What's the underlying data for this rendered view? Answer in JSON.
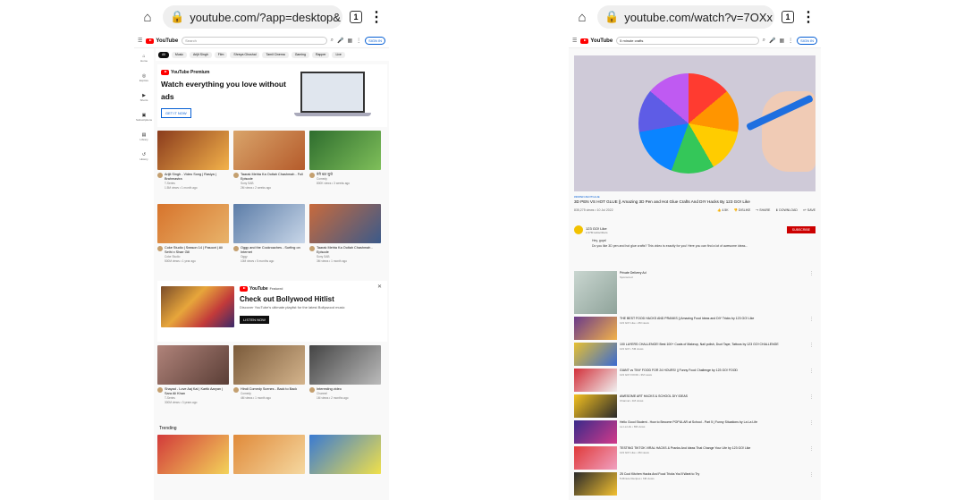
{
  "left": {
    "url": "youtube.com/?app=desktop&",
    "tab_count": "1",
    "yt": {
      "logo_text": "YouTube",
      "search_placeholder": "Search",
      "sign_in": "SIGN IN"
    },
    "rail": [
      "Home",
      "Explore",
      "Shorts",
      "Subscriptions",
      "Library",
      "History"
    ],
    "chips": [
      "All",
      "Music",
      "Arijit Singh",
      "Film",
      "Shreya Ghoshal",
      "Tamil Cinema",
      "Gaming",
      "Rapper",
      "Live"
    ],
    "promo": {
      "brand": "YouTube Premium",
      "title": "Watch everything you love without ads",
      "button": "GET IT NOW"
    },
    "videos": [
      {
        "title": "Arijit Singh - Video Song | Rasiya | Brahmastra",
        "channel": "T-Series",
        "meta": "1.5M views • 1 month ago",
        "c1": "#8a3b1d",
        "c2": "#f3b24a"
      },
      {
        "title": "Taarak Mehta Ka Ooltah Chashmah - Full Episode",
        "channel": "Sony SAB",
        "meta": "2M views • 2 weeks ago",
        "c1": "#d9a46a",
        "c2": "#b55b2b"
      },
      {
        "title": "मेरी बात सुनो",
        "channel": "Comedy",
        "meta": "800K views • 3 weeks ago",
        "c1": "#2e6d2e",
        "c2": "#7fbf5a"
      },
      {
        "title": "Coke Studio | Season 14 | Pasoori | Ali Sethi x Shae Gill",
        "channel": "Coke Studio",
        "meta": "500M views • 1 year ago",
        "c1": "#d7742c",
        "c2": "#e8b36a"
      },
      {
        "title": "Oggy and the Cockroaches - Surfing on Internet",
        "channel": "Oggy",
        "meta": "10M views • 5 months ago",
        "c1": "#5c7da8",
        "c2": "#c8d6e8"
      },
      {
        "title": "Taarak Mehta Ka Ooltah Chashmah - Episode",
        "channel": "Sony SAB",
        "meta": "3M views • 1 month ago",
        "c1": "#c86a3c",
        "c2": "#3b5a8a"
      },
      {
        "title": "Shayad - Love Aaj Kal | Kartik Aaryan | Sara Ali Khan",
        "channel": "T-Series",
        "meta": "300M views • 3 years ago",
        "c1": "#b0837a",
        "c2": "#5a3e36"
      },
      {
        "title": "Hindi Comedy Scenes - Back to Back",
        "channel": "Comedy",
        "meta": "4M views • 1 month ago",
        "c1": "#7a5a3a",
        "c2": "#d4b48c"
      },
      {
        "title": "Interesting video",
        "channel": "Channel",
        "meta": "1M views • 2 months ago",
        "c1": "#444444",
        "c2": "#bbbbbb"
      }
    ],
    "hitlist": {
      "brand": "YouTube",
      "tag": "Featured",
      "title": "Check out Bollywood Hitlist",
      "subtitle": "Discover YouTube's ultimate playlist for the latest Bollywood music",
      "button": "LISTEN NOW"
    },
    "trending_label": "Trending",
    "trending": [
      {
        "c1": "#d23a3a",
        "c2": "#f3d35a"
      },
      {
        "c1": "#e08a3a",
        "c2": "#f5d8a0"
      },
      {
        "c1": "#3a7ad2",
        "c2": "#f0e04a"
      }
    ]
  },
  "right": {
    "url": "youtube.com/watch?v=7OXx",
    "tab_count": "1",
    "search_value": "5 minute crafts",
    "video": {
      "tag": "#3DPEN #HOTGLUE",
      "title": "3D PEN VS HOT GLUE || Amazing 3D Pen and Hot Glue Crafts And DIY Hacks By 123 GO! Like",
      "views": "835,275 views • 10 Jul 2022",
      "likes": "4.5K",
      "dislike": "DISLIKE",
      "share": "SHARE",
      "download": "DOWNLOAD",
      "save": "SAVE"
    },
    "channel": {
      "name": "123 GO! Like",
      "subs": "2.47M subscribers",
      "subscribe": "SUBSCRIBE"
    },
    "description": [
      "Hey, guys!",
      "Do you like 3D pen and hot glue crafts? This video is exactly for you! Here you can find a lot of awesome ideas..."
    ],
    "related": [
      {
        "title": "Private Delivery Ad",
        "sub": "Sponsored",
        "c1": "#c9d6d0",
        "c2": "#8fa39a"
      },
      {
        "title": "THE BEST FOOD HACKS AND PRANKS || Amazing Food Ideas and DIY Tricks by 123 GO! Like",
        "sub": "123 GO! Like • 2M views",
        "c1": "#6a3a8a",
        "c2": "#f2b24a"
      },
      {
        "title": "100 LAYERS CHALLENGE! Best 100+ Coats of Makeup, Nail polish, Duct Tape, Tattoos by 123 GO! CHALLENGE",
        "sub": "123 GO! • 5M views",
        "c1": "#e7c030",
        "c2": "#3a6ad2"
      },
      {
        "title": "GIANT vs TINY FOOD FOR 24 HOURS! || Funny Food Challenge by 123 GO! FOOD",
        "sub": "123 GO! FOOD • 3M views",
        "c1": "#d2303a",
        "c2": "#f0f0f0"
      },
      {
        "title": "AWESOME ART HACKS & SCHOOL DIY IDEAS",
        "sub": "Channel • 1M views",
        "c1": "#f3c020",
        "c2": "#2a2a2a"
      },
      {
        "title": "Hello Good Student - How to Become POPULAR at School - Part 5 | Funny Situations by La La Life",
        "sub": "La La Life • 8M views",
        "c1": "#3a2a8a",
        "c2": "#d23a8a"
      },
      {
        "title": "TESTING TIKTOK VIRAL HACKS & Pranks And Ideas That Change Your Life by 123 GO! Like",
        "sub": "123 GO! Like • 4M views",
        "c1": "#e03a3a",
        "c2": "#f0a0c0"
      },
      {
        "title": "25 Cool Kitchen Hacks And Food Tricks You'll Want to Try",
        "sub": "5-Minute Recipes • 6M views",
        "c1": "#2a2a2a",
        "c2": "#f3c030"
      }
    ]
  }
}
